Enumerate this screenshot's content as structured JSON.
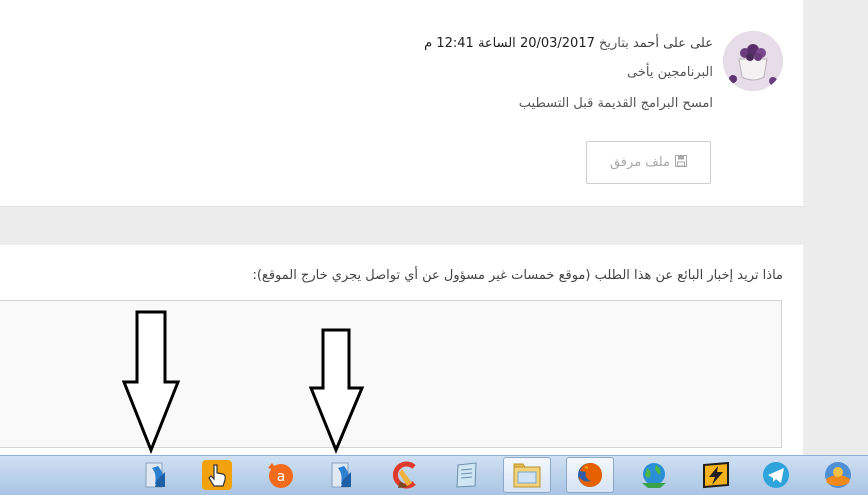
{
  "comment": {
    "author": "على على أحمد",
    "date_prefix": "بتاريخ",
    "date": "20/03/2017",
    "time_prefix": "الساعة",
    "time": "12:41 م",
    "line1": "البرنامجين يأخى",
    "line2": "امسح البرامج القديمة قبل التسطيب",
    "attachment_label": "ملف مرفق",
    "attachment_icon": "floppy-icon"
  },
  "report": {
    "question": "ماذا تريد إخبار البائع عن هذا الطلب (موقع خمسات غير مسؤول عن أي تواصل يجري خارج الموقع):",
    "textarea_value": ""
  },
  "taskbar": {
    "icons": [
      "installer-icon",
      "hand-pointer-icon",
      "avast-icon",
      "installer-icon",
      "ccleaner-icon",
      "notepad-icon",
      "file-explorer-icon",
      "firefox-icon",
      "network-globe-icon",
      "winamp-icon",
      "telegram-icon",
      "vlc-app-icon"
    ]
  },
  "colors": {
    "page_bg": "#ececec",
    "card_bg": "#ffffff",
    "taskbar_top": "#cfe0f2",
    "taskbar_bottom": "#a9c5e4"
  }
}
